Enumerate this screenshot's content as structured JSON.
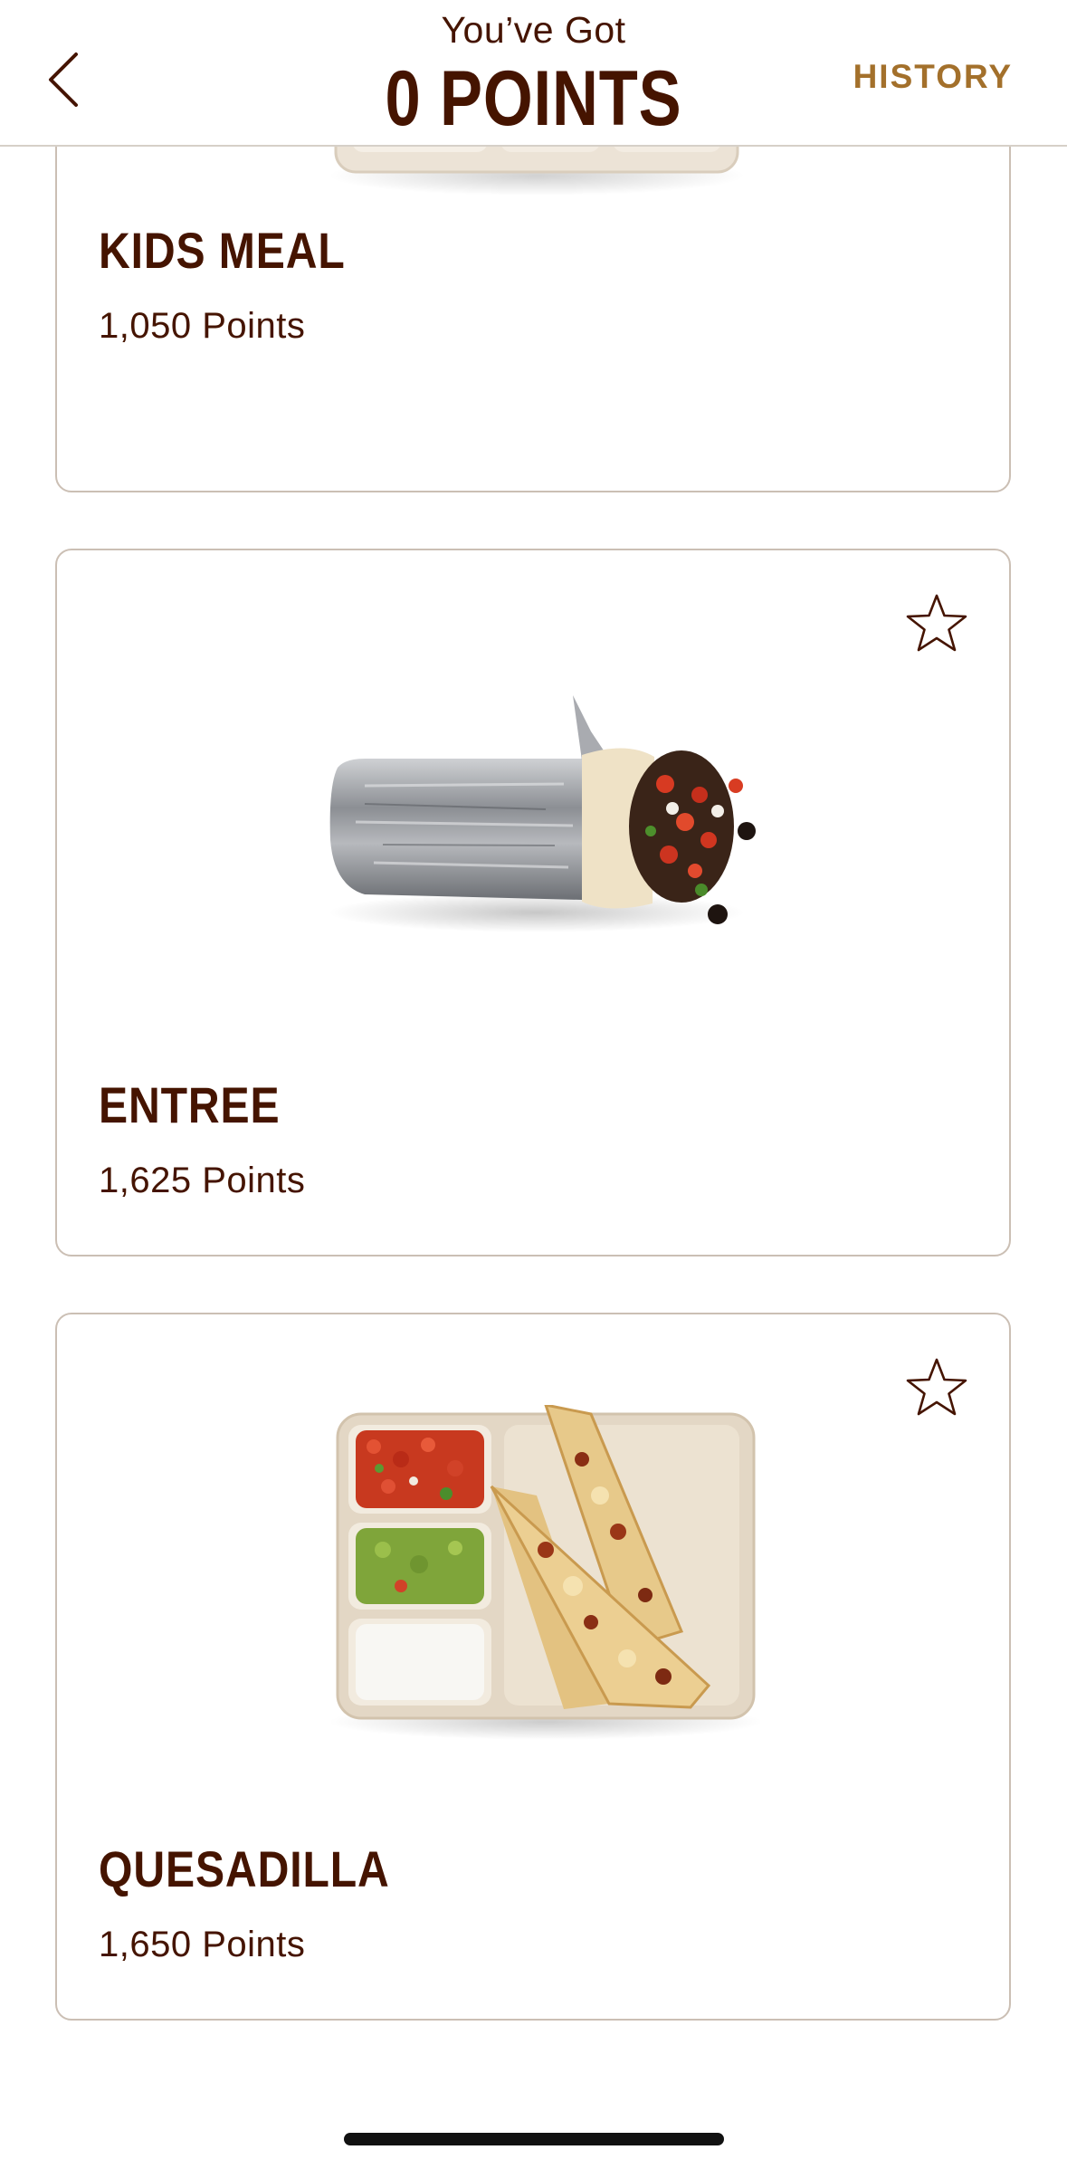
{
  "header": {
    "subtitle": "You’ve Got",
    "points_display": "0 POINTS",
    "history_label": "HISTORY",
    "back_icon": "chevron-left-icon"
  },
  "rewards": [
    {
      "title": "KIDS MEAL",
      "points": "1,050 Points"
    },
    {
      "title": "ENTREE",
      "points": "1,625 Points",
      "favorite_icon": "star-outline-icon"
    },
    {
      "title": "QUESADILLA",
      "points": "1,650 Points",
      "favorite_icon": "star-outline-icon"
    }
  ],
  "colors": {
    "brand_brown": "#451400",
    "accent_gold": "#a3702b",
    "card_border": "#cbbfb4"
  }
}
